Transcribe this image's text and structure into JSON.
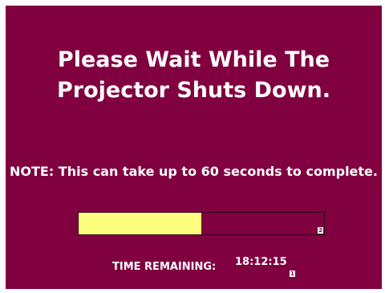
{
  "screen": {
    "background_color": "#800040",
    "text_color": "#ffffff",
    "title": "Please Wait While The Projector Shuts Down.",
    "note": "NOTE: This can take up to 60 seconds to complete."
  },
  "progress": {
    "fill_color": "#ffff80",
    "fraction": 0.5,
    "marker_text": "2"
  },
  "time": {
    "label": "TIME REMAINING:",
    "value": "18:12:15",
    "marker_text": "1"
  }
}
